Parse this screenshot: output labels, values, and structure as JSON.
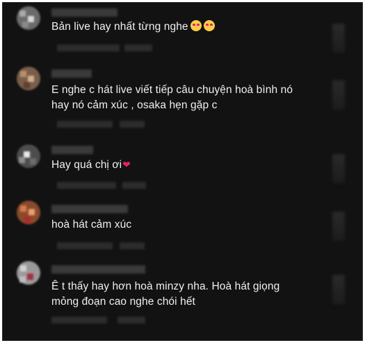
{
  "comments": [
    {
      "text": "Bản live hay nhất từng nghe",
      "emoji": [
        "star-struck-emoji",
        "star-struck-emoji"
      ]
    },
    {
      "text": "E nghe c hát live viết tiếp câu chuyện hoà bình nó",
      "text2": "hay nó cảm xúc , osaka hẹn gặp c"
    },
    {
      "text": "Hay quá chị ơi",
      "emoji": [
        "heart-emoji"
      ]
    },
    {
      "text": "hoà hát cảm xúc"
    },
    {
      "text": "Ê t thấy hay hơn hoà minzy nha. Hoà hát giọng",
      "text2": "mỏng đoạn cao nghe chói hết"
    }
  ],
  "colors": {
    "background": "#121212",
    "text": "#f0f0f0",
    "heart": "#e0245e"
  }
}
